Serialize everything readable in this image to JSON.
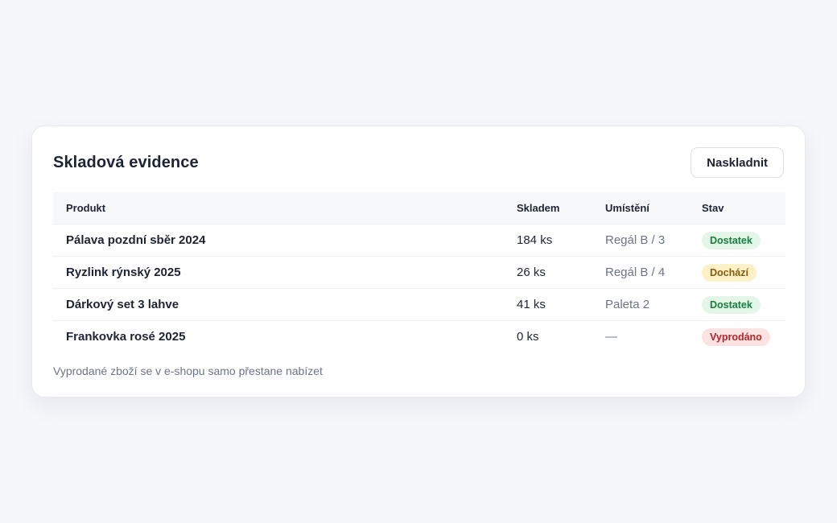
{
  "card": {
    "title": "Skladová evidence",
    "restock_button": "Naskladnit",
    "footnote": "Vyprodané zboží se v e-shopu samo přestane nabízet"
  },
  "table": {
    "headers": {
      "product": "Produkt",
      "stock": "Skladem",
      "location": "Umístění",
      "status": "Stav"
    },
    "rows": [
      {
        "product": "Pálava pozdní sběr 2024",
        "stock": "184 ks",
        "location": "Regál B / 3",
        "status": "Dostatek",
        "status_kind": "ok"
      },
      {
        "product": "Ryzlink rýnský 2025",
        "stock": "26 ks",
        "location": "Regál B / 4",
        "status": "Dochází",
        "status_kind": "low"
      },
      {
        "product": "Dárkový set 3 lahve",
        "stock": "41 ks",
        "location": "Paleta 2",
        "status": "Dostatek",
        "status_kind": "ok"
      },
      {
        "product": "Frankovka rosé 2025",
        "stock": "0 ks",
        "location": "—",
        "status": "Vyprodáno",
        "status_kind": "out"
      }
    ]
  },
  "colors": {
    "page_background": "#f6f7fb",
    "badge_ok": "#17803d",
    "badge_low": "#8a5a0b",
    "badge_out": "#b4232a"
  }
}
